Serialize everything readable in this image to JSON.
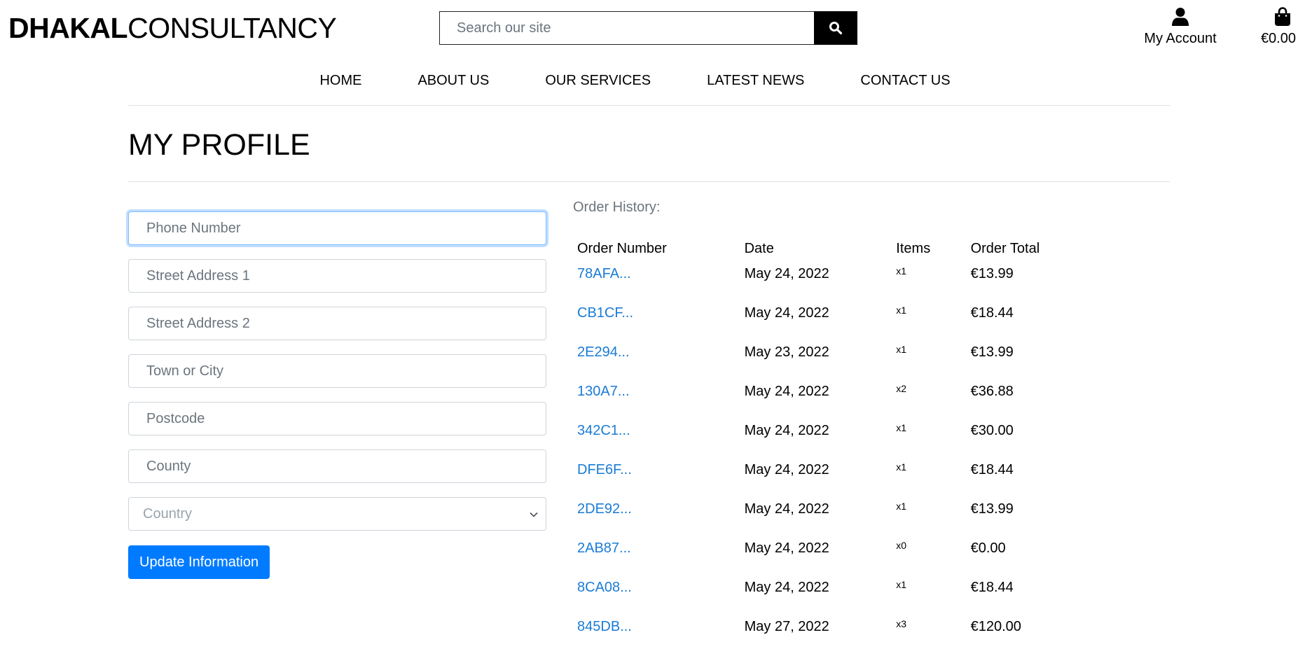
{
  "header": {
    "logo_bold": "DHAKAL",
    "logo_light": "CONSULTANCY",
    "search_placeholder": "Search our site",
    "account_label": "My Account",
    "cart_total": "€0.00"
  },
  "nav": {
    "items": [
      "HOME",
      "ABOUT US",
      "OUR SERVICES",
      "LATEST NEWS",
      "CONTACT US"
    ]
  },
  "page": {
    "title": "MY PROFILE"
  },
  "form": {
    "phone_placeholder": "Phone Number",
    "street1_placeholder": "Street Address 1",
    "street2_placeholder": "Street Address 2",
    "town_placeholder": "Town or City",
    "postcode_placeholder": "Postcode",
    "county_placeholder": "County",
    "country_selected": "Country",
    "submit_label": "Update Information"
  },
  "orders": {
    "label": "Order History:",
    "columns": [
      "Order Number",
      "Date",
      "Items",
      "Order Total"
    ],
    "rows": [
      {
        "number": "78AFA...",
        "date": "May 24, 2022",
        "items": "x1",
        "total": "€13.99"
      },
      {
        "number": "CB1CF...",
        "date": "May 24, 2022",
        "items": "x1",
        "total": "€18.44"
      },
      {
        "number": "2E294...",
        "date": "May 23, 2022",
        "items": "x1",
        "total": "€13.99"
      },
      {
        "number": "130A7...",
        "date": "May 24, 2022",
        "items": "x2",
        "total": "€36.88"
      },
      {
        "number": "342C1...",
        "date": "May 24, 2022",
        "items": "x1",
        "total": "€30.00"
      },
      {
        "number": "DFE6F...",
        "date": "May 24, 2022",
        "items": "x1",
        "total": "€18.44"
      },
      {
        "number": "2DE92...",
        "date": "May 24, 2022",
        "items": "x1",
        "total": "€13.99"
      },
      {
        "number": "2AB87...",
        "date": "May 24, 2022",
        "items": "x0",
        "total": "€0.00"
      },
      {
        "number": "8CA08...",
        "date": "May 24, 2022",
        "items": "x1",
        "total": "€18.44"
      },
      {
        "number": "845DB...",
        "date": "May 27, 2022",
        "items": "x3",
        "total": "€120.00"
      }
    ]
  },
  "colors": {
    "primary": "#007bff",
    "link": "#1a7bd6",
    "muted": "#6c757d",
    "divider": "#dee2e6"
  },
  "icons": {
    "search": "search-icon",
    "account": "user-icon",
    "cart": "shopping-bag-icon",
    "select": "chevron-down-icon"
  }
}
